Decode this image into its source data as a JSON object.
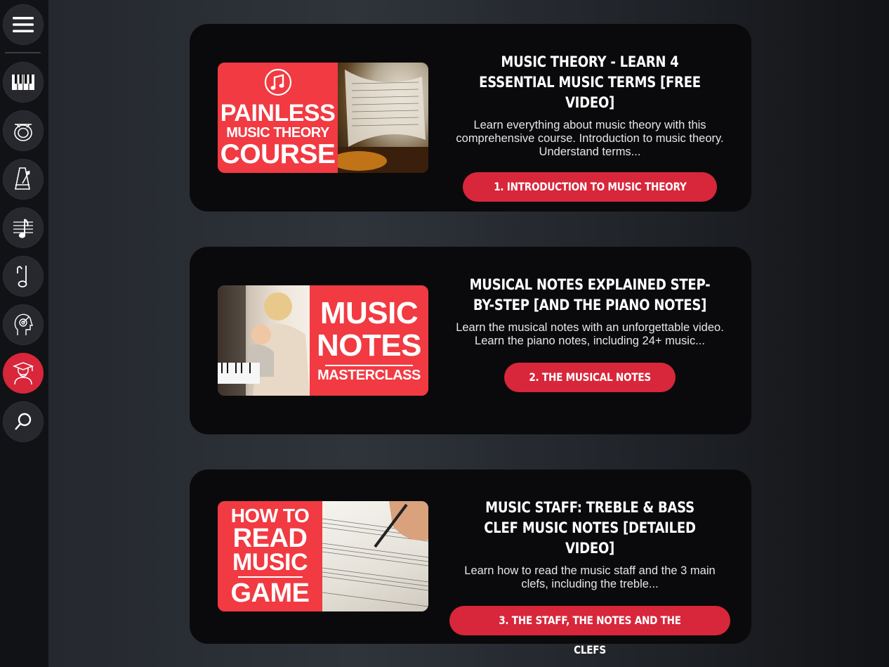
{
  "sidebar": {
    "items": [
      {
        "icon": "menu-icon"
      },
      {
        "icon": "piano-keys-icon"
      },
      {
        "icon": "drum-icon"
      },
      {
        "icon": "metronome-icon"
      },
      {
        "icon": "staff-note-icon"
      },
      {
        "icon": "music-note-icon"
      },
      {
        "icon": "ear-training-icon"
      },
      {
        "icon": "graduate-icon",
        "active": true
      },
      {
        "icon": "search-icon"
      }
    ]
  },
  "cards": [
    {
      "thumb_lines": [
        "PAINLESS",
        "MUSIC THEORY",
        "COURSE"
      ],
      "title": "Music Theory - Learn 4 Essential Music Terms [Free Video]",
      "description": "Learn everything about music theory with this comprehensive course. Introduction to music theory. Understand terms...",
      "button": "1. Introduction to Music Theory"
    },
    {
      "thumb_lines": [
        "MUSIC",
        "NOTES",
        "MASTERCLASS"
      ],
      "title": "Musical Notes Explained Step-by-Step [And the Piano Notes]",
      "description": "Learn the musical notes with an unforgettable video. Learn the piano notes, including 24+ music...",
      "button": "2. The Musical Notes"
    },
    {
      "thumb_lines": [
        "HOW TO",
        "READ",
        "MUSIC",
        "GAME"
      ],
      "title": "Music Staff: Treble & Bass Clef Music Notes [Detailed Video]",
      "description": "Learn how to read the music staff and the 3 main clefs, including the treble...",
      "button": "3. The Staff, the Notes and the Clefs"
    }
  ],
  "colors": {
    "accent": "#d8263a",
    "thumb_red": "#f13a42",
    "card_bg": "#0a0a0c",
    "sidebar_bg": "#111215"
  }
}
